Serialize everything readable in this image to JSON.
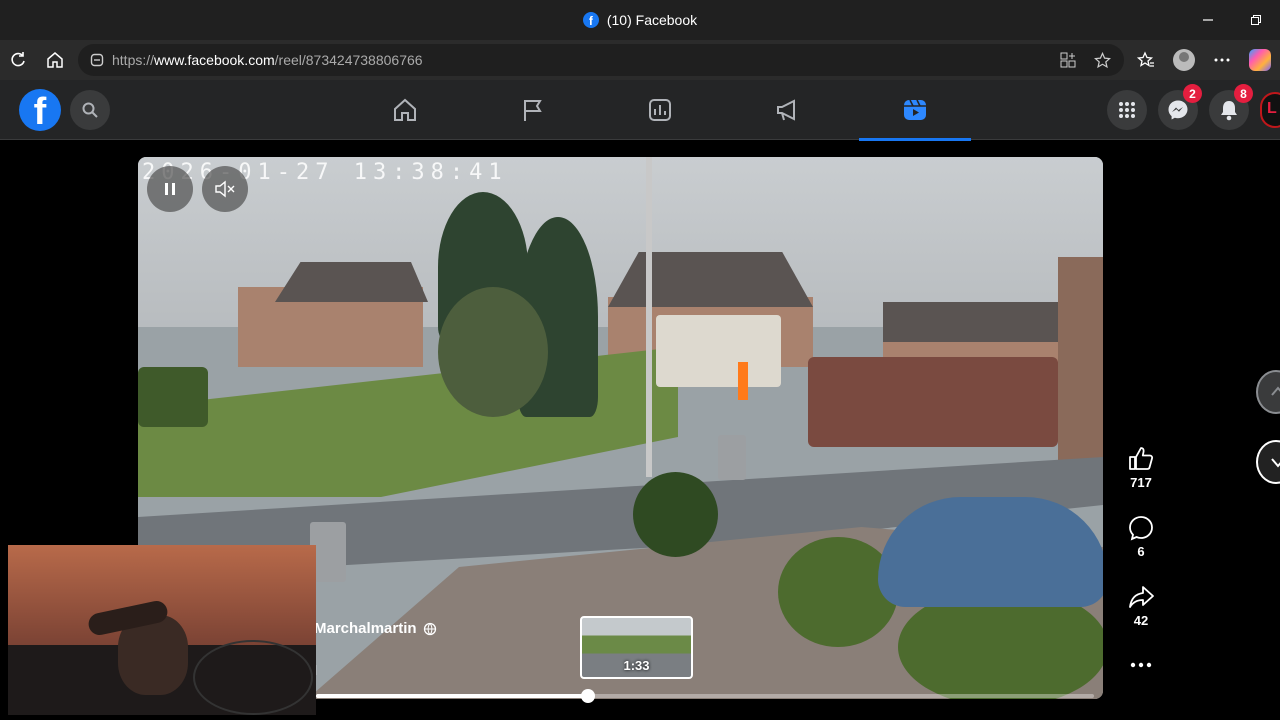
{
  "browser": {
    "tab_title": "(10) Facebook",
    "url_prefix": "https://",
    "url_domain": "www.facebook.com",
    "url_path": "/reel/873424738806766"
  },
  "nav": {
    "messenger_badge": "2",
    "notifications_badge": "8",
    "profile_initial": "L",
    "active_tab": "reels"
  },
  "video": {
    "timestamp": "2026-01-27  13:38:41",
    "author": "Marchalmartin",
    "author_sub": "l",
    "thumbnail_duration": "1:33",
    "progress": 0.35
  },
  "actions": {
    "likes": "717",
    "comments": "6",
    "shares": "42"
  },
  "colors": {
    "accent": "#1877f2",
    "badge": "#e41e3f"
  }
}
